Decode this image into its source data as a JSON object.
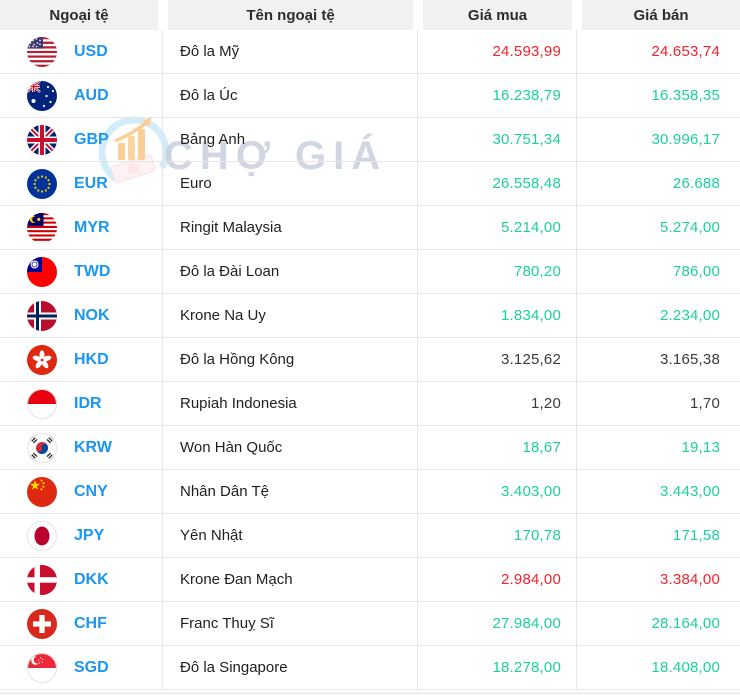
{
  "colors": {
    "up": "#1dcf9f",
    "down": "#f1232d",
    "flat": "#3b3b3b",
    "code_blue": "#1a96f3",
    "header_bg": "#f1f1f2",
    "header_text": "#2d2d2d",
    "row_border": "#e6e6e8",
    "name_text": "#1f1f1f",
    "watermark": "#c6ccdb"
  },
  "header": {
    "columns": [
      "Ngoại tệ",
      "Tên ngoại tệ",
      "Giá mua",
      "Giá bán"
    ]
  },
  "watermark": {
    "text": "CHỢ GIÁ",
    "logo_icon": "cho-gia-logo-icon"
  },
  "table": {
    "rows": [
      {
        "code": "USD",
        "flag": "usd-flag-icon",
        "name": "Đô la Mỹ",
        "buy": "24.593,99",
        "sell": "24.653,74",
        "trend": "down"
      },
      {
        "code": "AUD",
        "flag": "aud-flag-icon",
        "name": "Đô la Úc",
        "buy": "16.238,79",
        "sell": "16.358,35",
        "trend": "up"
      },
      {
        "code": "GBP",
        "flag": "gbp-flag-icon",
        "name": "Bảng Anh",
        "buy": "30.751,34",
        "sell": "30.996,17",
        "trend": "up"
      },
      {
        "code": "EUR",
        "flag": "eur-flag-icon",
        "name": "Euro",
        "buy": "26.558,48",
        "sell": "26.688",
        "trend": "up"
      },
      {
        "code": "MYR",
        "flag": "myr-flag-icon",
        "name": "Ringit Malaysia",
        "buy": "5.214,00",
        "sell": "5.274,00",
        "trend": "up"
      },
      {
        "code": "TWD",
        "flag": "twd-flag-icon",
        "name": "Đô la Đài Loan",
        "buy": "780,20",
        "sell": "786,00",
        "trend": "up"
      },
      {
        "code": "NOK",
        "flag": "nok-flag-icon",
        "name": "Krone Na Uy",
        "buy": "1.834,00",
        "sell": "2.234,00",
        "trend": "up"
      },
      {
        "code": "HKD",
        "flag": "hkd-flag-icon",
        "name": "Đô la Hồng Kông",
        "buy": "3.125,62",
        "sell": "3.165,38",
        "trend": "flat"
      },
      {
        "code": "IDR",
        "flag": "idr-flag-icon",
        "name": "Rupiah Indonesia",
        "buy": "1,20",
        "sell": "1,70",
        "trend": "flat"
      },
      {
        "code": "KRW",
        "flag": "krw-flag-icon",
        "name": "Won Hàn Quốc",
        "buy": "18,67",
        "sell": "19,13",
        "trend": "up"
      },
      {
        "code": "CNY",
        "flag": "cny-flag-icon",
        "name": "Nhân Dân Tệ",
        "buy": "3.403,00",
        "sell": "3.443,00",
        "trend": "up"
      },
      {
        "code": "JPY",
        "flag": "jpy-flag-icon",
        "name": "Yên Nhật",
        "buy": "170,78",
        "sell": "171,58",
        "trend": "up"
      },
      {
        "code": "DKK",
        "flag": "dkk-flag-icon",
        "name": "Krone Đan Mạch",
        "buy": "2.984,00",
        "sell": "3.384,00",
        "trend": "down"
      },
      {
        "code": "CHF",
        "flag": "chf-flag-icon",
        "name": "Franc Thuỵ Sĩ",
        "buy": "27.984,00",
        "sell": "28.164,00",
        "trend": "up"
      },
      {
        "code": "SGD",
        "flag": "sgd-flag-icon",
        "name": "Đô la Singapore",
        "buy": "18.278,00",
        "sell": "18.408,00",
        "trend": "up"
      }
    ]
  }
}
